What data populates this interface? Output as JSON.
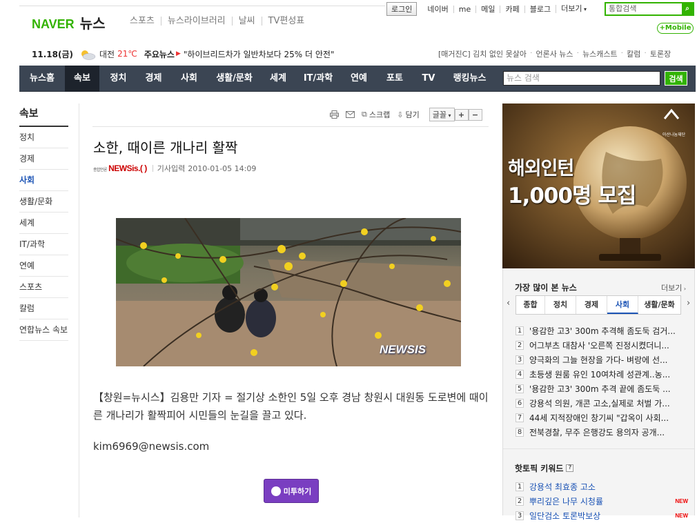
{
  "header": {
    "util": {
      "login": "로그인",
      "links": [
        "네이버",
        "me",
        "메일",
        "카페",
        "블로그",
        "더보기"
      ]
    },
    "search_placeholder": "통합검색",
    "mobile": "+Mobile",
    "logo_naver": "NAVER",
    "logo_news": "뉴스",
    "services": [
      "스포츠",
      "뉴스라이브러리",
      "날씨",
      "TV편성표"
    ]
  },
  "infobar": {
    "date": "11.18(금)",
    "city": "대전",
    "temp": "21℃",
    "headline_label": "주요뉴스",
    "headline": "\"하이브리드차가 일반차보다 25% 더 안전\"",
    "right_links": [
      "[매거진C] 김치 없인 못살아",
      "언론사 뉴스",
      "뉴스캐스트",
      "칼럼",
      "토론장"
    ]
  },
  "gnb": {
    "items": [
      "뉴스홈",
      "속보",
      "정치",
      "경제",
      "사회",
      "생활/문화",
      "세계",
      "IT/과학",
      "연예",
      "포토",
      "TV",
      "랭킹뉴스"
    ],
    "search_placeholder": "뉴스 검색",
    "search_button": "검색"
  },
  "lnb": {
    "title": "속보",
    "items": [
      "정치",
      "경제",
      "사회",
      "생활/문화",
      "세계",
      "IT/과학",
      "연예",
      "스포츠",
      "칼럼",
      "연합뉴스 속보"
    ]
  },
  "article": {
    "toolbar": {
      "print": "",
      "mail": "",
      "scrap": "스크랩",
      "save": "담기",
      "font": "글꼴",
      "plus": "+",
      "minus": "−"
    },
    "title": "소한, 때이른 개나리 활짝",
    "press_small": "종합언론",
    "press": "NEWSis.( )",
    "input_label": "기사입력",
    "date": "2010-01-05 14:09",
    "photo_watermark": "NEWSIS",
    "body": "【창원=뉴시스】김용만 기자 = 절기상 소한인 5일 오후 경남 창원시 대원동 도로변에 때이른 개나리가 활짝피어 시민들의 눈길을 끌고 있다.",
    "email": "kim6969@newsis.com",
    "me2day": "미투하기"
  },
  "ad": {
    "line1": "해외인턴",
    "line2": "1,000명 모집",
    "brand": "아산나눔재단"
  },
  "popular": {
    "title": "가장 많이 본 뉴스",
    "more": "더보기",
    "tabs": [
      "종합",
      "정치",
      "경제",
      "사회",
      "생활/문화"
    ],
    "items": [
      "'용감한 고3' 300m 추격해 좀도둑 검거...",
      "어그부츠 대참사 '오른쪽 진정시켰더니...",
      "양극화의 그늘 현장을 가다- 벼랑에 선...",
      "초등생 원룸 유인 10여차례 성관계..농...",
      "'용감한 고3' 300m 추격 끝에 좀도둑 ...",
      "강용석 의원, 개콘 고소,실제로 처벌 가...",
      "44세 지적장애인 창기씨 \"갑옥이 사회...",
      "전북경찰, 무주 은행강도 용의자 공개..."
    ]
  },
  "hottopic": {
    "title": "핫토픽 키워드",
    "help": "?",
    "items": [
      {
        "num": "1",
        "text": "강용석 최효종 고소",
        "new": ""
      },
      {
        "num": "2",
        "text": "뿌리깊은 나무 시청률",
        "new": "NEW"
      },
      {
        "num": "3",
        "text": "일단검소 토론박보상",
        "new": "NEW"
      }
    ]
  },
  "colors": {
    "green": "#32b300",
    "gnb": "#3b4553",
    "active_blue": "#1b53b5"
  }
}
